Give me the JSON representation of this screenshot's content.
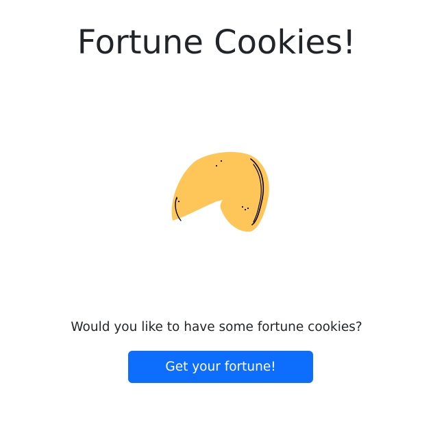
{
  "page": {
    "title": "Fortune Cookies!",
    "question": "Would you like to have some fortune cookies?",
    "button_label": "Get your fortune!"
  },
  "illustration": {
    "icon": "fortune-cookie-icon",
    "fill_color": "#fec659",
    "outline_color": "#000000"
  },
  "colors": {
    "text": "#212529",
    "button_bg": "#0d6efd",
    "button_text": "#ffffff",
    "background": "#ffffff"
  }
}
